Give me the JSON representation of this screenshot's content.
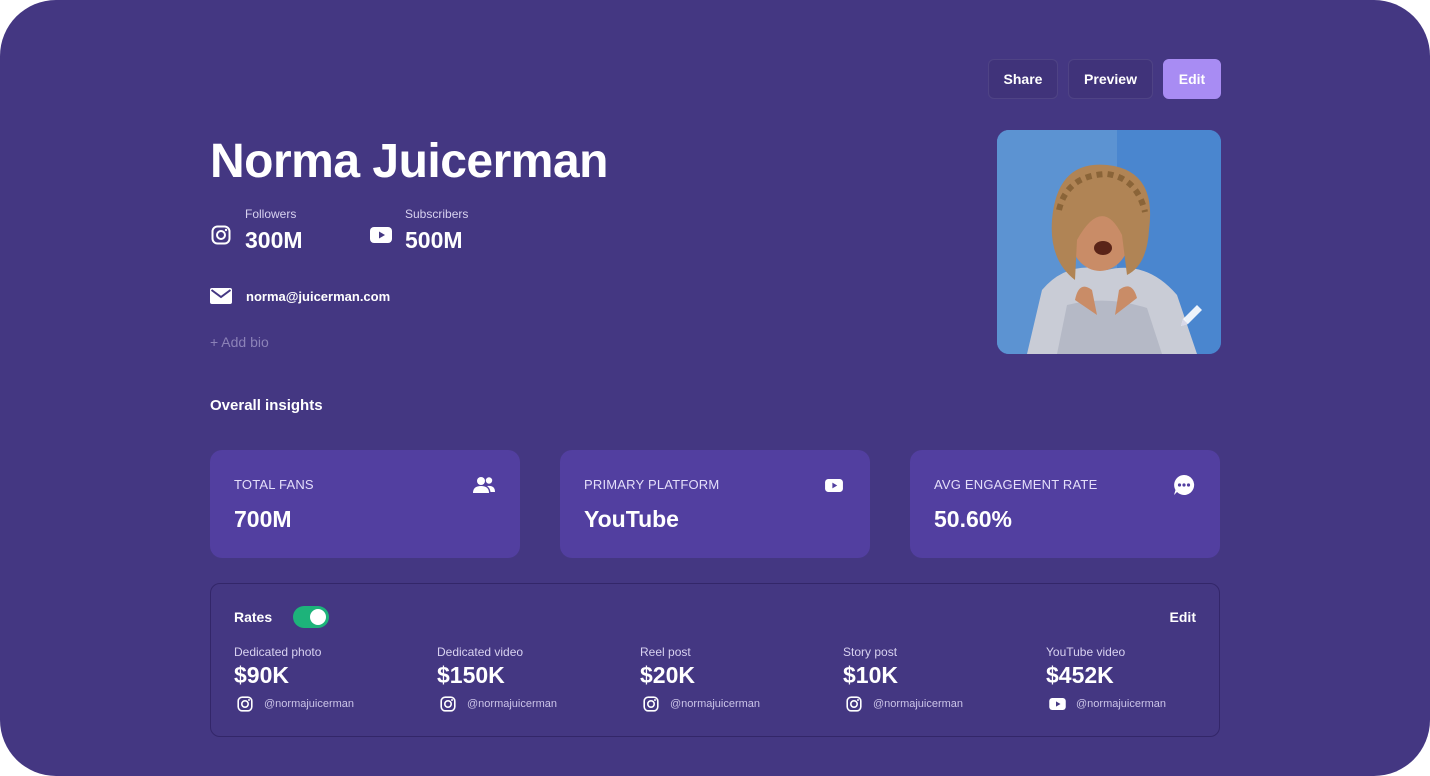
{
  "header": {
    "share_label": "Share",
    "preview_label": "Preview",
    "edit_label": "Edit"
  },
  "profile": {
    "name": "Norma Juicerman",
    "followers_label": "Followers",
    "followers_value": "300M",
    "subscribers_label": "Subscribers",
    "subscribers_value": "500M",
    "email": "norma@juicerman.com",
    "add_bio": "+ Add bio"
  },
  "insights": {
    "title": "Overall insights",
    "cards": [
      {
        "label": "TOTAL FANS",
        "value": "700M",
        "icon": "people-icon"
      },
      {
        "label": "PRIMARY PLATFORM",
        "value": "YouTube",
        "icon": "youtube-icon"
      },
      {
        "label": "AVG ENGAGEMENT RATE",
        "value": "50.60%",
        "icon": "chat-bubble-icon"
      }
    ]
  },
  "rates": {
    "title": "Rates",
    "toggle_on": true,
    "edit_label": "Edit",
    "items": [
      {
        "label": "Dedicated photo",
        "value": "$90K",
        "handle": "@normajuicerman",
        "platform_icon": "instagram-icon"
      },
      {
        "label": "Dedicated video",
        "value": "$150K",
        "handle": "@normajuicerman",
        "platform_icon": "instagram-icon"
      },
      {
        "label": "Reel post",
        "value": "$20K",
        "handle": "@normajuicerman",
        "platform_icon": "instagram-icon"
      },
      {
        "label": "Story post",
        "value": "$10K",
        "handle": "@normajuicerman",
        "platform_icon": "instagram-icon"
      },
      {
        "label": "YouTube video",
        "value": "$452K",
        "handle": "@normajuicerman",
        "platform_icon": "youtube-icon"
      }
    ]
  },
  "colors": {
    "background": "#443782",
    "card": "#523fa0",
    "accent": "#a88cf3",
    "toggle": "#1db37a"
  }
}
